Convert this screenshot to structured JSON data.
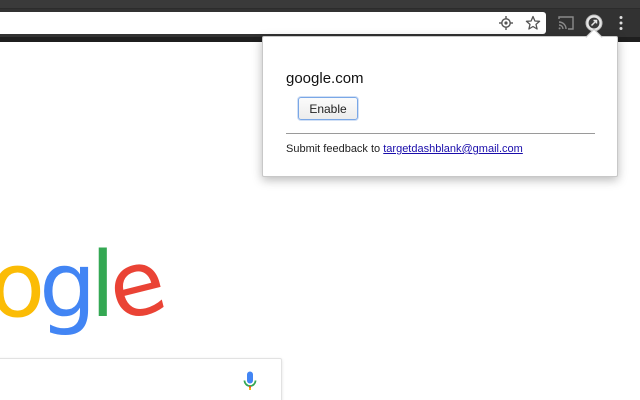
{
  "browser": {
    "omnibox": {
      "value": ""
    },
    "icons": [
      "location-target-icon",
      "star-icon",
      "cast-icon",
      "extension-icon",
      "menu-dots-icon"
    ]
  },
  "page": {
    "logo_letters": [
      {
        "char": "o",
        "color": "#FBBC05"
      },
      {
        "char": "g",
        "color": "#4285F4"
      },
      {
        "char": "l",
        "color": "#34A853"
      },
      {
        "char": "e",
        "color": "#EA4335"
      }
    ],
    "mic_icon": "microphone-icon"
  },
  "popup": {
    "domain": "google.com",
    "enable_label": "Enable",
    "feedback_prefix": "Submit feedback to ",
    "feedback_email": "targetdashblank@gmail.com"
  },
  "colors": {
    "chrome_dark": "#323232",
    "link": "#1a0dab",
    "button_focus": "#7aa7e6"
  }
}
